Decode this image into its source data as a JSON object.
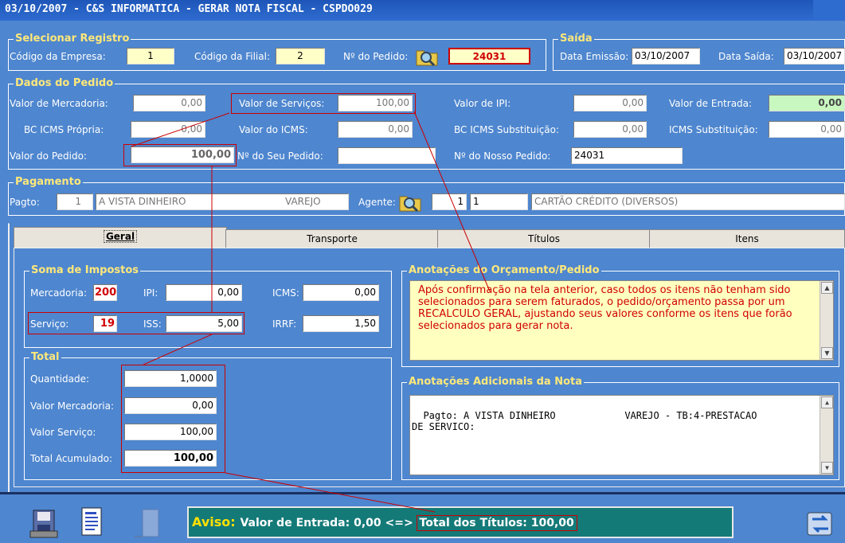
{
  "title": "03/10/2007 - C&S INFORMATICA - GERAR NOTA FISCAL - CSPDO029",
  "selecionar": {
    "legend": "Selecionar Registro",
    "cod_empresa_label": "Código da Empresa:",
    "cod_empresa": "1",
    "cod_filial_label": "Código da Filial:",
    "cod_filial": "2",
    "num_pedido_label": "Nº do Pedido:",
    "num_pedido": "24031"
  },
  "saida": {
    "legend": "Saída",
    "data_emissao_label": "Data Emissão:",
    "data_emissao": "03/10/2007",
    "data_saida_label": "Data Saída:",
    "data_saida": "03/10/2007"
  },
  "dados": {
    "legend": "Dados do Pedido",
    "valor_mercadoria_label": "Valor de Mercadoria:",
    "valor_mercadoria": "0,00",
    "valor_servicos_label": "Valor de Serviços:",
    "valor_servicos": "100,00",
    "valor_ipi_label": "Valor de IPI:",
    "valor_ipi": "0,00",
    "valor_entrada_label": "Valor de Entrada:",
    "valor_entrada": "0,00",
    "bc_icms_label": "BC ICMS Própria:",
    "bc_icms": "0,00",
    "valor_icms_label": "Valor do ICMS:",
    "valor_icms": "0,00",
    "bc_icms_sub_label": "BC ICMS Substituição:",
    "bc_icms_sub": "0,00",
    "icms_sub_label": "ICMS Substituição:",
    "icms_sub": "0,00",
    "valor_pedido_label": "Valor do Pedido:",
    "valor_pedido": "100,00",
    "seu_pedido_label": "Nº do Seu Pedido:",
    "seu_pedido": "",
    "nosso_pedido_label": "Nº do Nosso Pedido:",
    "nosso_pedido": "24031"
  },
  "pagamento": {
    "legend": "Pagamento",
    "pagto_label": "Pagto:",
    "pagto_code": "1",
    "pagto_desc": "A VISTA DINHEIRO",
    "pagto_tipo": "VAREJO",
    "agente_label": "Agente:",
    "agente_1": "1",
    "agente_2": "1",
    "agente_desc": "CARTÃO CRÉDITO (DIVERSOS)"
  },
  "tabs": [
    {
      "label": "Geral"
    },
    {
      "label": "Transporte"
    },
    {
      "label": "Títulos"
    },
    {
      "label": "Itens"
    }
  ],
  "impostos": {
    "legend": "Soma de Impostos",
    "mercadoria_label": "Mercadoria:",
    "mercadoria": "200",
    "ipi_label": "IPI:",
    "ipi": "0,00",
    "icms_label": "ICMS:",
    "icms": "0,00",
    "servico_label": "Serviço:",
    "servico": "19",
    "iss_label": "ISS:",
    "iss": "5,00",
    "irrf_label": "IRRF:",
    "irrf": "1,50"
  },
  "total": {
    "legend": "Total",
    "quantidade_label": "Quantidade:",
    "quantidade": "1,0000",
    "valor_mercadoria_label": "Valor Mercadoria:",
    "valor_mercadoria": "0,00",
    "valor_servico_label": "Valor Serviço:",
    "valor_servico": "100,00",
    "total_acumulado_label": "Total Acumulado:",
    "total_acumulado": "100,00"
  },
  "anotacoes": {
    "legend": "Anotações do Orçamento/Pedido",
    "text": "Após confirmação na tela anterior, caso todos os itens não tenham sido selecionados para serem faturados, o pedido/orçamento passa por um RECALCULO GERAL, ajustando seus valores conforme os itens que forão selecionados para gerar nota."
  },
  "adicionais": {
    "legend": "Anotações Adicionais da Nota",
    "text": "Pagto: A VISTA DINHEIRO            VAREJO - TB:4-PRESTACAO\nDE SERVICO:"
  },
  "aviso": {
    "label": "Aviso:",
    "text1": "Valor de Entrada: 0,00 <=>",
    "text2": "Total dos Títulos: 100,00"
  },
  "colors": {
    "title_bar": "#2f6cd0",
    "background": "#4e86cf",
    "legend": "#ffe87a",
    "aviso_bg": "#147a78",
    "highlight": "#cc0000"
  }
}
